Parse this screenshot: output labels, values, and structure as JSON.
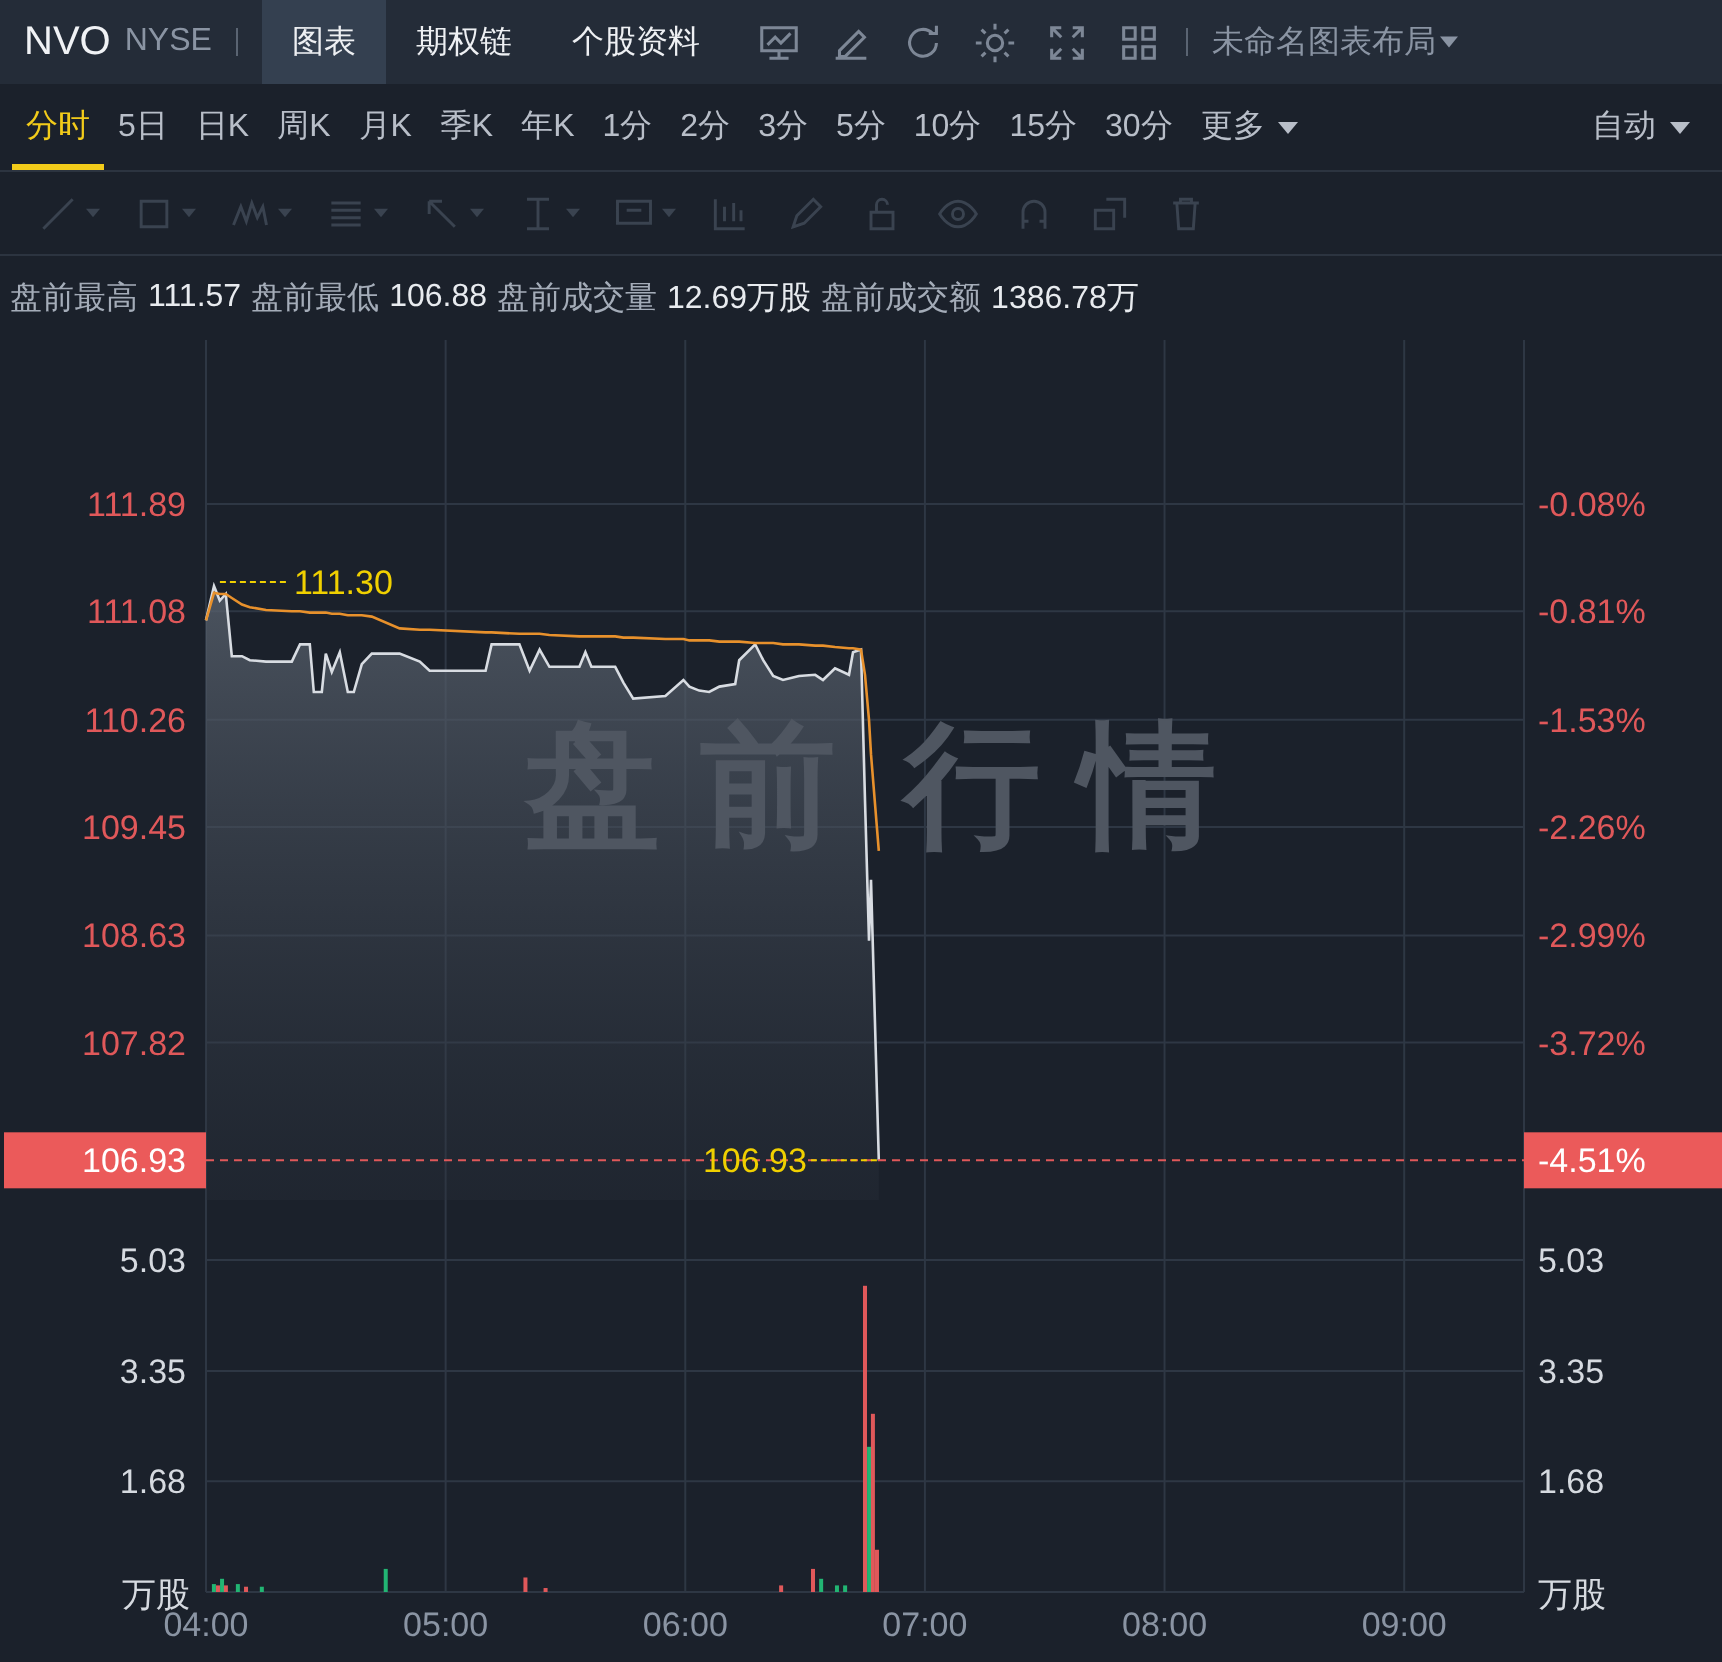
{
  "header": {
    "symbol": "NVO",
    "exchange": "NYSE",
    "tabs": [
      {
        "label": "图表",
        "selected": true
      },
      {
        "label": "期权链",
        "selected": false
      },
      {
        "label": "个股资料",
        "selected": false
      }
    ],
    "layout_name": "未命名图表布局"
  },
  "periods": [
    {
      "label": "分时",
      "selected": true,
      "kind": "plain"
    },
    {
      "label": "5日",
      "selected": false,
      "kind": "plain"
    },
    {
      "label": "日K",
      "selected": false,
      "kind": "plain"
    },
    {
      "label": "周K",
      "selected": false,
      "kind": "plain"
    },
    {
      "label": "月K",
      "selected": false,
      "kind": "plain"
    },
    {
      "label": "季K",
      "selected": false,
      "kind": "plain"
    },
    {
      "label": "年K",
      "selected": false,
      "kind": "plain"
    },
    {
      "label": "1分",
      "selected": false,
      "kind": "plain"
    },
    {
      "label": "2分",
      "selected": false,
      "kind": "plain"
    },
    {
      "label": "3分",
      "selected": false,
      "kind": "plain"
    },
    {
      "label": "5分",
      "selected": false,
      "kind": "plain"
    },
    {
      "label": "10分",
      "selected": false,
      "kind": "plain"
    },
    {
      "label": "15分",
      "selected": false,
      "kind": "plain"
    },
    {
      "label": "30分",
      "selected": false,
      "kind": "plain"
    },
    {
      "label": "更多",
      "selected": false,
      "kind": "dropdown"
    }
  ],
  "chart_type": "自动",
  "drawing_toolbar": {
    "disabled": true
  },
  "stats": [
    {
      "label": "盘前最高",
      "value": "111.57"
    },
    {
      "label": "盘前最低",
      "value": "106.88"
    },
    {
      "label": "盘前成交量",
      "value": "12.69万股"
    },
    {
      "label": "盘前成交额",
      "value": "1386.78万"
    }
  ],
  "price_chart": {
    "overlay_text": "盘前行情",
    "current": {
      "change": "-4.51%"
    },
    "percent_ticks": [
      "-0.08%",
      "-0.81%",
      "-1.53%",
      "-2.26%",
      "-2.99%",
      "-3.72%"
    ],
    "chart_data": {
      "type": "line",
      "xlim": [
        4,
        9.5
      ],
      "ylim": [
        106.63,
        113.13
      ],
      "grid": true,
      "ref_lines": [
        {
          "axis": "y",
          "value": 106.93,
          "label": "106.93",
          "color": "#e0585a"
        }
      ],
      "yticks": [
        {
          "value": 111.89,
          "label": "111.89"
        },
        {
          "value": 111.08,
          "label": "111.08"
        },
        {
          "value": 110.26,
          "label": "110.26"
        },
        {
          "value": 109.45,
          "label": "109.45"
        },
        {
          "value": 108.63,
          "label": "108.63"
        },
        {
          "value": 107.82,
          "label": "107.82"
        }
      ],
      "x": [
        4,
        4.033,
        4.058,
        4.083,
        4.108,
        4.15,
        4.183,
        4.25,
        4.358,
        4.392,
        4.433,
        4.45,
        4.483,
        4.5,
        4.525,
        4.558,
        4.592,
        4.617,
        4.65,
        4.692,
        4.808,
        4.892,
        4.933,
        5.167,
        5.192,
        5.308,
        5.35,
        5.392,
        5.433,
        5.558,
        5.583,
        5.608,
        5.708,
        5.742,
        5.783,
        5.917,
        5.992,
        6.017,
        6.058,
        6.1,
        6.142,
        6.208,
        6.225,
        6.292,
        6.325,
        6.367,
        6.408,
        6.475,
        6.542,
        6.575,
        6.625,
        6.683,
        6.7,
        6.733,
        6.75,
        6.767,
        6.775,
        6.808
      ],
      "series": [
        {
          "color": "#d8dce2",
          "values": [
            111.01,
            111.27,
            111.16,
            111.21,
            110.74,
            110.74,
            110.71,
            110.7,
            110.7,
            110.83,
            110.83,
            110.47,
            110.47,
            110.76,
            110.62,
            110.77,
            110.47,
            110.47,
            110.68,
            110.76,
            110.76,
            110.7,
            110.63,
            110.63,
            110.83,
            110.83,
            110.63,
            110.79,
            110.66,
            110.66,
            110.77,
            110.66,
            110.66,
            110.54,
            110.42,
            110.44,
            110.56,
            110.51,
            110.48,
            110.47,
            110.51,
            110.53,
            110.71,
            110.83,
            110.71,
            110.59,
            110.56,
            110.59,
            110.6,
            110.56,
            110.65,
            110.6,
            110.77,
            110.79,
            109.65,
            108.59,
            109.05,
            106.93
          ]
        },
        {
          "color": "#e8912c",
          "values": [
            111.01,
            111.22,
            111.21,
            111.21,
            111.18,
            111.13,
            111.11,
            111.09,
            111.08,
            111.08,
            111.07,
            111.07,
            111.07,
            111.07,
            111.06,
            111.06,
            111.05,
            111.05,
            111.05,
            111.04,
            110.95,
            110.94,
            110.94,
            110.92,
            110.92,
            110.91,
            110.91,
            110.91,
            110.9,
            110.89,
            110.89,
            110.89,
            110.89,
            110.88,
            110.88,
            110.87,
            110.87,
            110.86,
            110.86,
            110.86,
            110.85,
            110.85,
            110.85,
            110.84,
            110.84,
            110.84,
            110.83,
            110.83,
            110.82,
            110.82,
            110.81,
            110.8,
            110.8,
            110.79,
            110.6,
            110.26,
            110.0,
            109.27
          ]
        }
      ],
      "annotations": [
        {
          "x": 4.033,
          "y": 111.3,
          "text": "111.30"
        },
        {
          "x": 6.808,
          "y": 106.93,
          "text": "106.93"
        }
      ]
    }
  },
  "volume_chart": {
    "unit": "万股",
    "right_unit": "万股",
    "right_ticks": [
      "5.03",
      "3.35",
      "1.68"
    ],
    "chart_data": {
      "type": "bar",
      "xlim": [
        4,
        9.5
      ],
      "ylim": [
        0,
        5.94
      ],
      "grid": true,
      "x": [
        4.033,
        4.05,
        4.067,
        4.083,
        4.133,
        4.167,
        4.233,
        4.75,
        5.333,
        5.417,
        6.4,
        6.533,
        6.567,
        6.633,
        6.667,
        6.75,
        6.767,
        6.783,
        6.8
      ],
      "series": [
        {
          "color": "#e0585a",
          "values": [
            null,
            0.1,
            null,
            0.1,
            null,
            0.08,
            null,
            null,
            0.22,
            0.06,
            0.1,
            0.35,
            null,
            null,
            null,
            4.64,
            null,
            2.7,
            0.64
          ]
        },
        {
          "color": "#22b573",
          "values": [
            0.12,
            null,
            0.2,
            null,
            0.12,
            null,
            0.08,
            0.35,
            null,
            null,
            null,
            null,
            0.2,
            0.1,
            0.1,
            null,
            2.2,
            null,
            null
          ]
        }
      ],
      "yticks": [
        {
          "value": 5.03,
          "label": "5.03"
        },
        {
          "value": 3.35,
          "label": "3.35"
        },
        {
          "value": 1.68,
          "label": "1.68"
        }
      ],
      "xticks": [
        {
          "value": 4,
          "label": "04:00"
        },
        {
          "value": 5,
          "label": "05:00"
        },
        {
          "value": 6,
          "label": "06:00"
        },
        {
          "value": 7,
          "label": "07:00"
        },
        {
          "value": 8,
          "label": "08:00"
        },
        {
          "value": 9,
          "label": "09:00"
        }
      ]
    }
  }
}
